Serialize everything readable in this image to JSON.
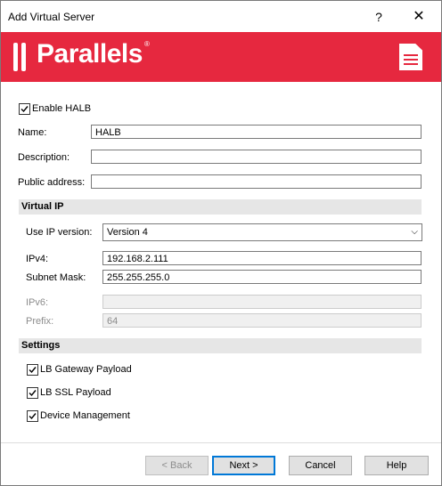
{
  "window": {
    "title": "Add Virtual Server",
    "help_symbol": "?",
    "close_symbol": "✕"
  },
  "banner": {
    "logo_text": "Parallels",
    "registered": "®",
    "icon": "document-icon",
    "bg_color": "#e6283f"
  },
  "form": {
    "enable_halb": {
      "label": "Enable HALB",
      "checked": true
    },
    "name": {
      "label": "Name:",
      "value": "HALB"
    },
    "description": {
      "label": "Description:",
      "value": ""
    },
    "public_address": {
      "label": "Public address:",
      "value": ""
    }
  },
  "virtual_ip": {
    "heading": "Virtual IP",
    "ip_version": {
      "label": "Use IP version:",
      "value": "Version 4"
    },
    "ipv4": {
      "label": "IPv4:",
      "value": "192.168.2.111"
    },
    "subnet_mask": {
      "label": "Subnet Mask:",
      "value": "255.255.255.0"
    },
    "ipv6": {
      "label": "IPv6:",
      "value": ""
    },
    "prefix": {
      "label": "Prefix:",
      "value": "64"
    }
  },
  "settings": {
    "heading": "Settings",
    "lb_gateway": {
      "label": "LB Gateway Payload",
      "checked": true
    },
    "lb_ssl": {
      "label": "LB SSL Payload",
      "checked": true
    },
    "device_mgmt": {
      "label": "Device Management",
      "checked": true
    }
  },
  "buttons": {
    "back": "< Back",
    "next": "Next >",
    "cancel": "Cancel",
    "help": "Help"
  }
}
